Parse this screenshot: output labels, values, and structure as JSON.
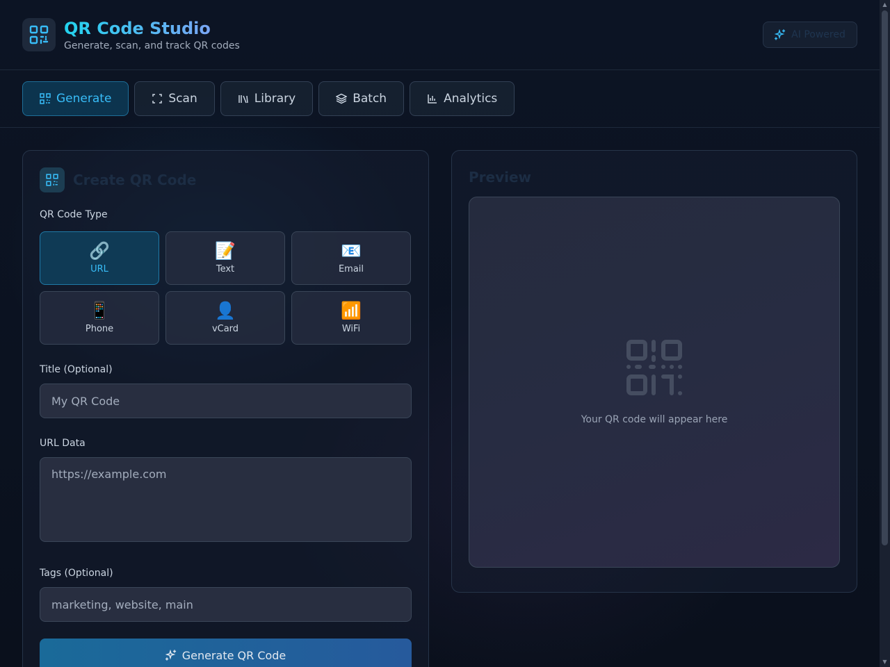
{
  "header": {
    "title": "QR Code Studio",
    "subtitle": "Generate, scan, and track QR codes",
    "badge": "AI Powered"
  },
  "tabs": [
    {
      "label": "Generate",
      "icon": "qr-icon",
      "active": true
    },
    {
      "label": "Scan",
      "icon": "scan-icon",
      "active": false
    },
    {
      "label": "Library",
      "icon": "library-icon",
      "active": false
    },
    {
      "label": "Batch",
      "icon": "layers-icon",
      "active": false
    },
    {
      "label": "Analytics",
      "icon": "chart-icon",
      "active": false
    }
  ],
  "generator": {
    "title": "Create QR Code",
    "type_label": "QR Code Type",
    "types": [
      {
        "label": "URL",
        "icon": "🔗",
        "active": true
      },
      {
        "label": "Text",
        "icon": "📝",
        "active": false
      },
      {
        "label": "Email",
        "icon": "📧",
        "active": false
      },
      {
        "label": "Phone",
        "icon": "📱",
        "active": false
      },
      {
        "label": "vCard",
        "icon": "👤",
        "active": false
      },
      {
        "label": "WiFi",
        "icon": "📶",
        "active": false
      }
    ],
    "title_field": {
      "label": "Title (Optional)",
      "placeholder": "My QR Code",
      "value": ""
    },
    "data_field": {
      "label": "URL Data",
      "placeholder": "https://example.com",
      "value": ""
    },
    "tags_field": {
      "label": "Tags (Optional)",
      "placeholder": "marketing, website, main",
      "value": ""
    },
    "generate_label": "Generate QR Code"
  },
  "preview": {
    "title": "Preview",
    "empty_text": "Your QR code will appear here"
  },
  "colors": {
    "accent": "#38bdf8",
    "background": "#0b1120",
    "panel_border": "#263449"
  }
}
